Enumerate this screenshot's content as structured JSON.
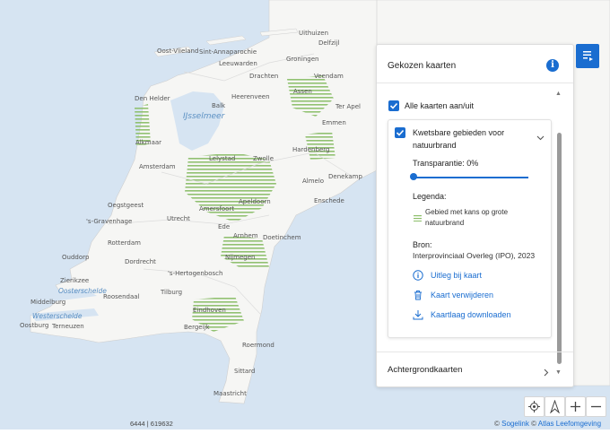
{
  "map": {
    "cities": [
      "Uithuizen",
      "Delfzijl",
      "Oost-Vlieland",
      "Sint-Annaparochie",
      "Groningen",
      "Leeuwarden",
      "Veendam",
      "Drachten",
      "Assen",
      "Den Helder",
      "Heerenveen",
      "Balk",
      "Emmen",
      "Ter Apel",
      "Alkmaar",
      "Lelystad",
      "Zwolle",
      "Hardenberg",
      "Amsterdam",
      "Almelo",
      "Denekamp",
      "Oegstgeest",
      "Amersfoort",
      "Apeldoorn",
      "Enschede",
      "'s-Gravenhage",
      "Utrecht",
      "Ede",
      "Rotterdam",
      "Arnhem",
      "Doetinchem",
      "Ouddorp",
      "Dordrecht",
      "Nijmegen",
      "Zierikzee",
      "'s-Hertogenbosch",
      "Middelburg",
      "Roosendaal",
      "Tilburg",
      "Oostburg",
      "Terneuzen",
      "Eindhoven",
      "Bergeijk",
      "Roermond",
      "Sittard",
      "Maastricht"
    ],
    "water_labels": [
      "IJsselmeer",
      "Oosterschelde",
      "Westerschelde"
    ]
  },
  "panel": {
    "title": "Gekozen kaarten",
    "info_icon": "info-icon",
    "all_layers_label": "Alle kaarten aan/uit",
    "all_layers_checked": true,
    "layer": {
      "checked": true,
      "title": "Kwetsbare gebieden voor natuurbrand",
      "transparency_label": "Transparantie: 0%",
      "transparency_value": 0,
      "legend_label": "Legenda:",
      "legend_item": "Gebied met kans op grote natuurbrand",
      "legend_color": "#8cbf6a",
      "source_label": "Bron:",
      "source_value": "Interprovinciaal Overleg (IPO), 2023",
      "actions": [
        "Uitleg bij kaart",
        "Kaart verwijderen",
        "Kaartlaag downloaden"
      ],
      "action_icons": [
        "info-circle-icon",
        "trash-icon",
        "download-icon"
      ]
    },
    "background_maps_label": "Achtergrondkaarten"
  },
  "toolbar": {
    "toggle_icon": "layers-list-icon",
    "tools": [
      "locate-icon",
      "north-arrow-icon",
      "zoom-in-icon",
      "zoom-out-icon"
    ]
  },
  "footer": {
    "coordinates": "6444 | 619632",
    "copyright_symbol1": "©",
    "copyright_link1": "Sogelink",
    "copyright_symbol2": "©",
    "copyright_link2": "Atlas Leefomgeving"
  },
  "colors": {
    "accent": "#1a6dd0",
    "water": "#d6e4f2",
    "land": "#f6f6f4",
    "risk": "#8cbf6a"
  }
}
